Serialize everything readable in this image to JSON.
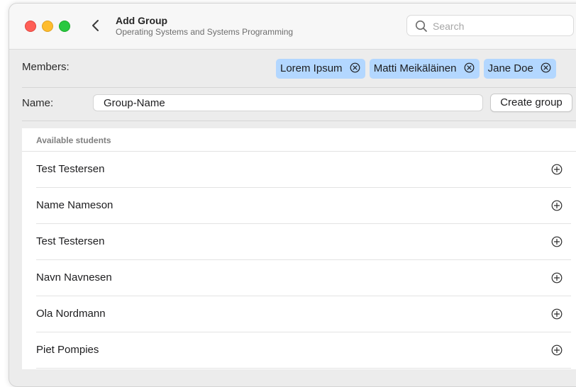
{
  "window": {
    "title": "Add Group",
    "subtitle": "Operating Systems and Systems Programming"
  },
  "search": {
    "placeholder": "Search",
    "value": ""
  },
  "members": {
    "label": "Members:",
    "chips": [
      {
        "name": "Lorem Ipsum"
      },
      {
        "name": "Matti Meikäläinen"
      },
      {
        "name": "Jane Doe"
      }
    ]
  },
  "name_row": {
    "label": "Name:",
    "value": "Group-Name",
    "create_button": "Create group"
  },
  "available": {
    "header": "Available students",
    "students": [
      {
        "name": "Test Testersen"
      },
      {
        "name": "Name Nameson"
      },
      {
        "name": "Test Testersen"
      },
      {
        "name": "Navn Navnesen"
      },
      {
        "name": "Ola Nordmann"
      },
      {
        "name": "Piet Pompies"
      }
    ]
  },
  "icons": {
    "back": "chevron-left-icon",
    "search": "magnifier-icon",
    "remove": "circle-x-icon",
    "add": "circle-plus-icon"
  },
  "colors": {
    "chip_background": "#b3d7ff",
    "close": "#ff5f57",
    "minimize": "#febc2e",
    "zoom": "#28c840"
  }
}
